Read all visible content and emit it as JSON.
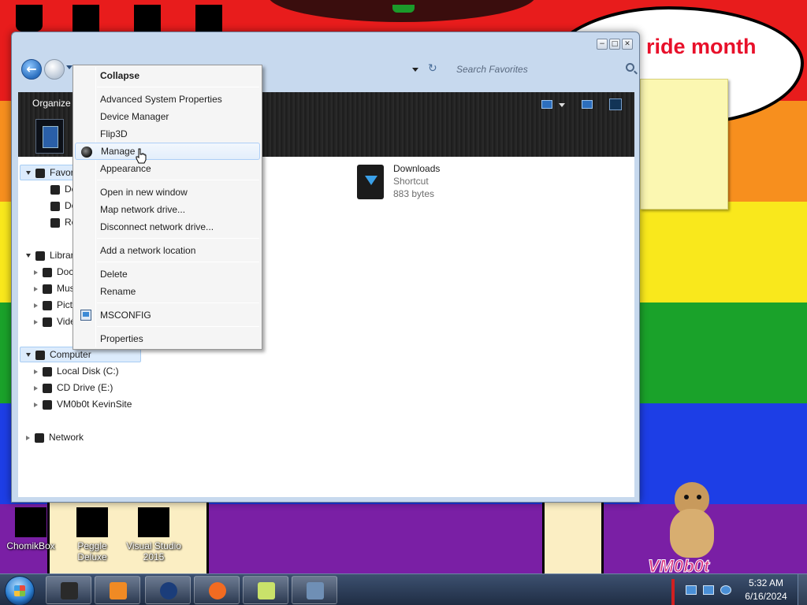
{
  "desktop": {
    "stripes": [
      "#e81c1c",
      "#f78f1e",
      "#f9e81c",
      "#1aa22a",
      "#1d3ee6",
      "#7a1fa5"
    ],
    "speech_text": "ride month",
    "icons": [
      {
        "label": "ChomikBox"
      },
      {
        "label": "Peggle Deluxe"
      },
      {
        "label": "Visual Studio 2015"
      }
    ],
    "hamster_label": "VM0b0t"
  },
  "window": {
    "controls": [
      "−",
      "□",
      "✕"
    ],
    "search_placeholder": "Search Favorites",
    "organize_label": "Organize",
    "nav_tree": [
      {
        "label": "Favorites",
        "icon": "favorites-star-icon",
        "expander": "open",
        "selected": true
      },
      {
        "label": "Desktop",
        "icon": "desktop-icon"
      },
      {
        "label": "Downloads",
        "icon": "downloads-folder-icon"
      },
      {
        "label": "Recent Places",
        "icon": "recent-places-icon"
      },
      {
        "label": "Libraries",
        "icon": "libraries-icon",
        "expander": "open"
      },
      {
        "label": "Documents",
        "icon": "documents-icon",
        "expander": "closed"
      },
      {
        "label": "Music",
        "icon": "music-icon",
        "expander": "closed"
      },
      {
        "label": "Pictures",
        "icon": "pictures-icon",
        "expander": "closed"
      },
      {
        "label": "Videos",
        "icon": "videos-icon",
        "expander": "closed"
      },
      {
        "label": "Computer",
        "icon": "computer-icon",
        "expander": "open",
        "selected": true
      },
      {
        "label": "Local Disk (C:)",
        "icon": "local-disk-icon",
        "expander": "closed"
      },
      {
        "label": "CD Drive (E:)",
        "icon": "cd-drive-icon",
        "expander": "closed"
      },
      {
        "label": "VM0b0t KevinSite",
        "icon": "network-location-icon",
        "expander": "closed"
      },
      {
        "label": "Network",
        "icon": "network-icon",
        "expander": "closed"
      }
    ],
    "file": {
      "name": "Downloads",
      "type": "Shortcut",
      "size": "883 bytes"
    }
  },
  "context_menu": {
    "items": [
      {
        "label": "Collapse",
        "bold": true
      },
      {
        "separator": true
      },
      {
        "label": "Advanced System Properties"
      },
      {
        "label": "Device Manager"
      },
      {
        "label": "Flip3D"
      },
      {
        "label": "Manage",
        "hover": true,
        "icon": "manage-globe-icon"
      },
      {
        "label": "Appearance"
      },
      {
        "separator": true
      },
      {
        "label": "Open in new window"
      },
      {
        "label": "Map network drive..."
      },
      {
        "label": "Disconnect network drive..."
      },
      {
        "separator": true
      },
      {
        "label": "Add a network location"
      },
      {
        "separator": true
      },
      {
        "label": "Delete"
      },
      {
        "label": "Rename"
      },
      {
        "separator": true
      },
      {
        "label": "MSCONFIG",
        "icon": "msconfig-monitor-icon"
      },
      {
        "separator": true
      },
      {
        "label": "Properties"
      }
    ]
  },
  "taskbar": {
    "time": "5:32 AM",
    "date": "6/16/2024",
    "buttons": [
      {
        "name": "explorer-taskbar-button",
        "color": "#2a2a2a"
      },
      {
        "name": "media-player-taskbar-button",
        "color": "#f08a24"
      },
      {
        "name": "globe-taskbar-button",
        "color": "#1b3d7a"
      },
      {
        "name": "firefox-taskbar-button",
        "color": "#f26b21"
      },
      {
        "name": "sticky-notes-taskbar-button",
        "color": "#c9e26a"
      },
      {
        "name": "network-taskbar-button",
        "color": "#6f8fb5"
      }
    ]
  }
}
